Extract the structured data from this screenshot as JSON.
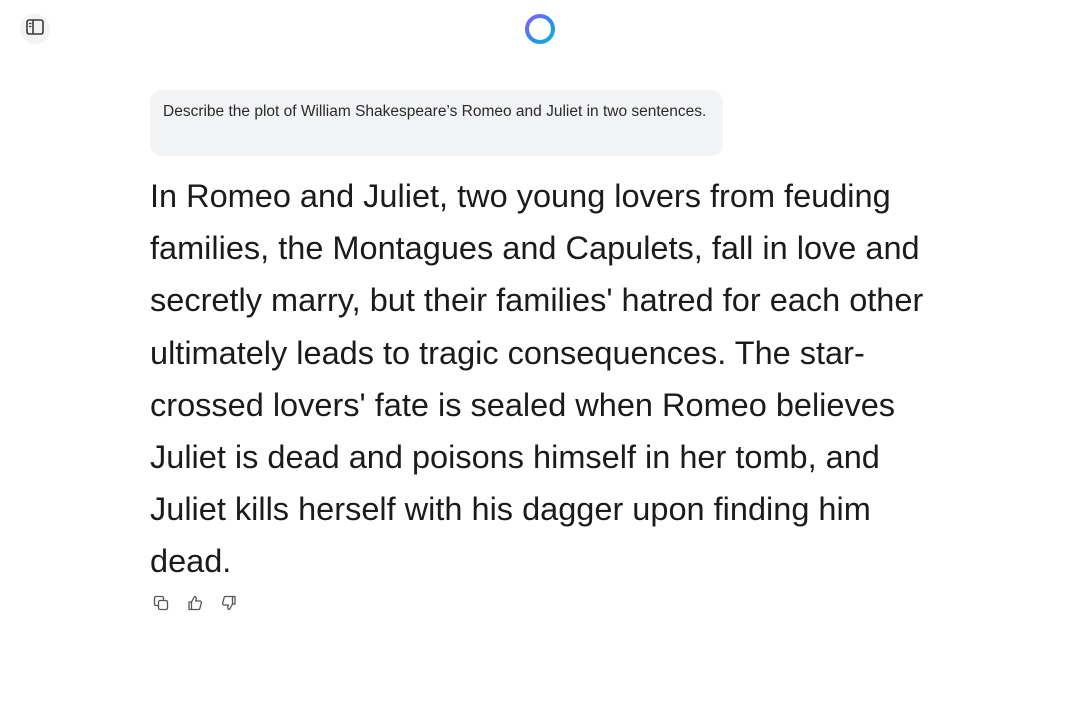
{
  "header": {
    "sidebar_toggle_icon": "sidebar-panel-icon",
    "logo_icon": "gradient-ring-logo",
    "logo_colors": [
      "#3b82f6",
      "#8b5cf6",
      "#06b6d4"
    ]
  },
  "conversation": {
    "user_message": "Describe the plot of William Shakespeare’s Romeo and Juliet in two sentences.",
    "assistant_message": "In Romeo and Juliet, two young lovers from feuding families, the Montagues and Capulets, fall in love and secretly marry, but their families' hatred for each other ultimately leads to tragic consequences. The star-crossed lovers' fate is sealed when Romeo believes Juliet is dead and poisons himself in her tomb, and Juliet kills herself with his dagger upon finding him dead."
  },
  "actions": [
    {
      "icon": "copy-icon"
    },
    {
      "icon": "thumbs-up-icon"
    },
    {
      "icon": "thumbs-down-icon"
    }
  ],
  "colors": {
    "bubble_background": "#f2f3f5",
    "text": "#1b1b1b",
    "icon": "#555555"
  }
}
